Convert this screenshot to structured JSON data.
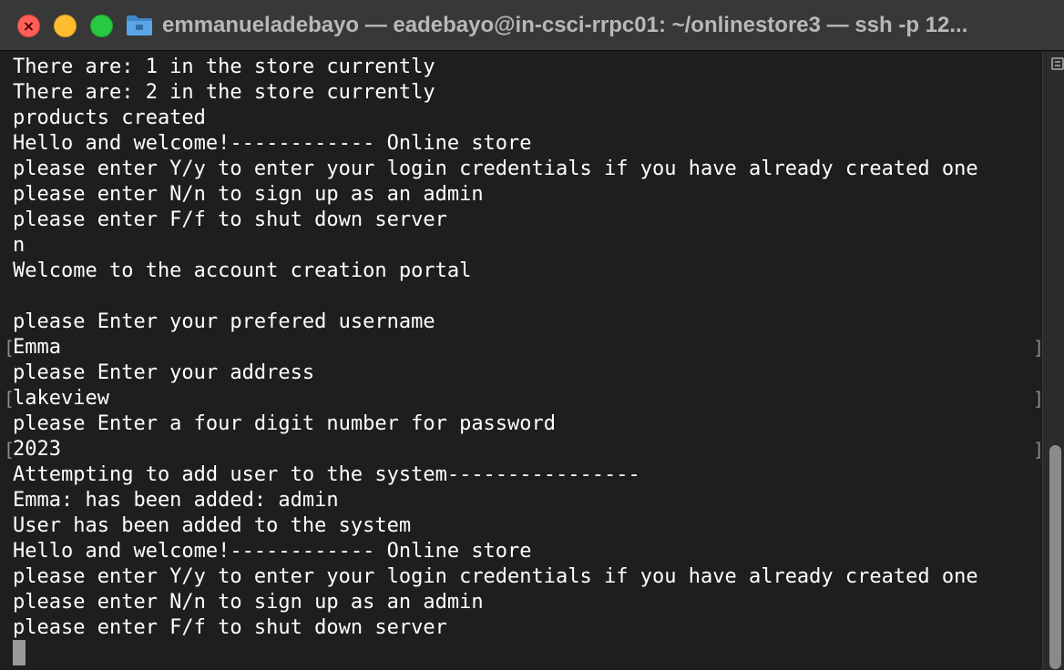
{
  "window": {
    "title": "emmanueladebayo — eadebayo@in-csci-rrpc01: ~/onlinestore3 — ssh -p 12...",
    "folder_icon": "folder-icon",
    "colors": {
      "background": "#1e1e1e",
      "titlebar": "#383838",
      "close": "#ff5f57",
      "minimize": "#febc2e",
      "zoom": "#28c840",
      "text": "#ffffff"
    }
  },
  "terminal": {
    "lines": [
      "There are: 1 in the store currently",
      "There are: 2 in the store currently",
      "products created",
      "Hello and welcome!------------ Online store",
      "please enter Y/y to enter your login credentials if you have already created one",
      "please enter N/n to sign up as an admin",
      "please enter F/f to shut down server",
      "n",
      "Welcome to the account creation portal",
      "",
      "please Enter your prefered username",
      "Emma",
      "please Enter your address",
      "lakeview",
      "please Enter a four digit number for password",
      "2023",
      "Attempting to add user to the system----------------",
      "Emma: has been added: admin",
      "User has been added to the system",
      "Hello and welcome!------------ Online store",
      "please enter Y/y to enter your login credentials if you have already created one",
      "please enter N/n to sign up as an admin",
      "please enter F/f to shut down server"
    ],
    "bracketed_inputs": {
      "left": "[",
      "right": "]"
    }
  }
}
